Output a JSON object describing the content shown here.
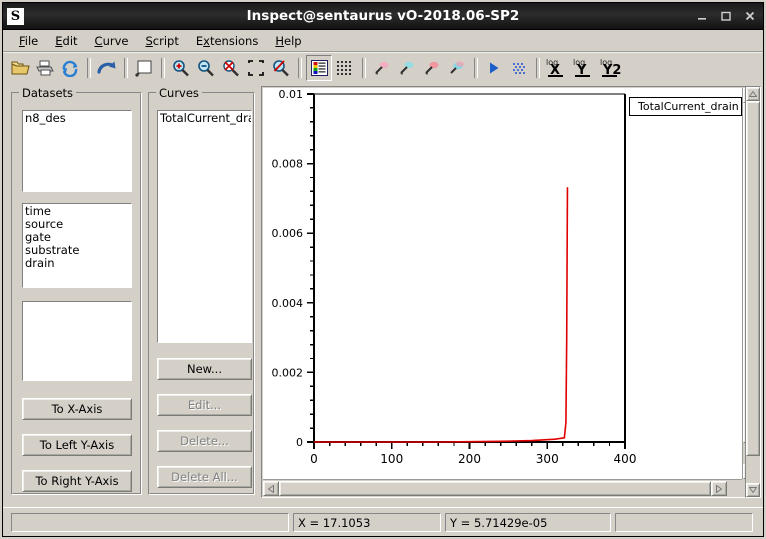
{
  "window": {
    "title": "Inspect@sentaurus vO-2018.06-SP2",
    "icon_letter": "S",
    "minimize_label": "minimize-icon",
    "maximize_label": "maximize-icon",
    "close_label": "close-icon"
  },
  "menubar": {
    "items": [
      {
        "label": "File",
        "mnemonic": "F"
      },
      {
        "label": "Edit",
        "mnemonic": "E"
      },
      {
        "label": "Curve",
        "mnemonic": "C"
      },
      {
        "label": "Script",
        "mnemonic": "S"
      },
      {
        "label": "Extensions",
        "mnemonic": "x"
      },
      {
        "label": "Help",
        "mnemonic": "H"
      }
    ]
  },
  "toolbar": {
    "buttons": [
      {
        "name": "open-folder-icon",
        "title": "Open"
      },
      {
        "name": "print-icon",
        "title": "Print"
      },
      {
        "name": "refresh-icon",
        "title": "Reload"
      },
      {
        "name": "undo-arrow-icon",
        "title": "Undo"
      },
      {
        "name": "new-plot-icon",
        "title": "New Plot"
      },
      {
        "name": "zoom-in-icon",
        "title": "Zoom In"
      },
      {
        "name": "zoom-out-icon",
        "title": "Zoom Out"
      },
      {
        "name": "zoom-cancel-icon",
        "title": "Cancel Zoom"
      },
      {
        "name": "zoom-fit-icon",
        "title": "Zoom to Fit"
      },
      {
        "name": "zoom-reset-icon",
        "title": "Reset Zoom"
      },
      {
        "name": "color-palette-icon",
        "title": "Colors"
      },
      {
        "name": "grid-icon",
        "title": "Grid"
      },
      {
        "name": "curve-marker-1-icon",
        "title": "Curve Style 1"
      },
      {
        "name": "curve-marker-2-icon",
        "title": "Curve Style 2"
      },
      {
        "name": "curve-marker-3-icon",
        "title": "Curve Style 3"
      },
      {
        "name": "curve-marker-4-icon",
        "title": "Curve Style 4"
      },
      {
        "name": "run-icon",
        "title": "Run"
      },
      {
        "name": "dither-icon",
        "title": "Dither"
      },
      {
        "name": "log-x-icon",
        "title": "log X"
      },
      {
        "name": "log-y-icon",
        "title": "log Y"
      },
      {
        "name": "log-y2-icon",
        "title": "log Y2"
      }
    ],
    "log_x_label": "X",
    "log_y_label": "Y",
    "log_y2_label": "Y2",
    "log_prefix": "log"
  },
  "datasets_panel": {
    "title": "Datasets",
    "files": [
      "n8_des"
    ],
    "variables": [
      "time",
      "source",
      "gate",
      "substrate",
      "drain"
    ],
    "third_list": [],
    "buttons": [
      {
        "label": "To X-Axis",
        "enabled": true
      },
      {
        "label": "To Left Y-Axis",
        "enabled": true
      },
      {
        "label": "To Right Y-Axis",
        "enabled": true
      }
    ]
  },
  "curves_panel": {
    "title": "Curves",
    "curves": [
      "TotalCurrent_drain"
    ],
    "buttons": [
      {
        "label": "New...",
        "enabled": true
      },
      {
        "label": "Edit...",
        "enabled": false
      },
      {
        "label": "Delete...",
        "enabled": false
      },
      {
        "label": "Delete All...",
        "enabled": false
      }
    ]
  },
  "statusbar": {
    "message": "",
    "x_readout": "X = 17.1053",
    "y_readout": "Y = 5.71429e-05",
    "extra": ""
  },
  "chart_data": {
    "type": "line",
    "title": "",
    "xlabel": "",
    "ylabel": "",
    "xlim": [
      0,
      400
    ],
    "ylim": [
      0,
      0.01
    ],
    "xticks": [
      0,
      100,
      200,
      300,
      400
    ],
    "xticklabels": [
      "0",
      "100",
      "200",
      "300",
      "400"
    ],
    "yticks": [
      0,
      0.002,
      0.004,
      0.006,
      0.008,
      0.01
    ],
    "yticklabels": [
      "0",
      "0.002",
      "0.004",
      "0.006",
      "0.008",
      "0.01"
    ],
    "x_minor_per_major": 5,
    "y_minor_per_major": 5,
    "grid": false,
    "legend_position": "top-right",
    "series": [
      {
        "name": "TotalCurrent_drain",
        "color": "#e00000",
        "x": [
          0,
          40,
          80,
          120,
          160,
          200,
          240,
          280,
          310,
          322,
          324,
          325,
          325.5,
          326
        ],
        "y": [
          0,
          0.0,
          0.0,
          0.0,
          0.0,
          1e-05,
          2e-05,
          4e-05,
          8e-05,
          0.00012,
          0.00055,
          0.0029,
          0.0052,
          0.00732
        ]
      }
    ]
  }
}
